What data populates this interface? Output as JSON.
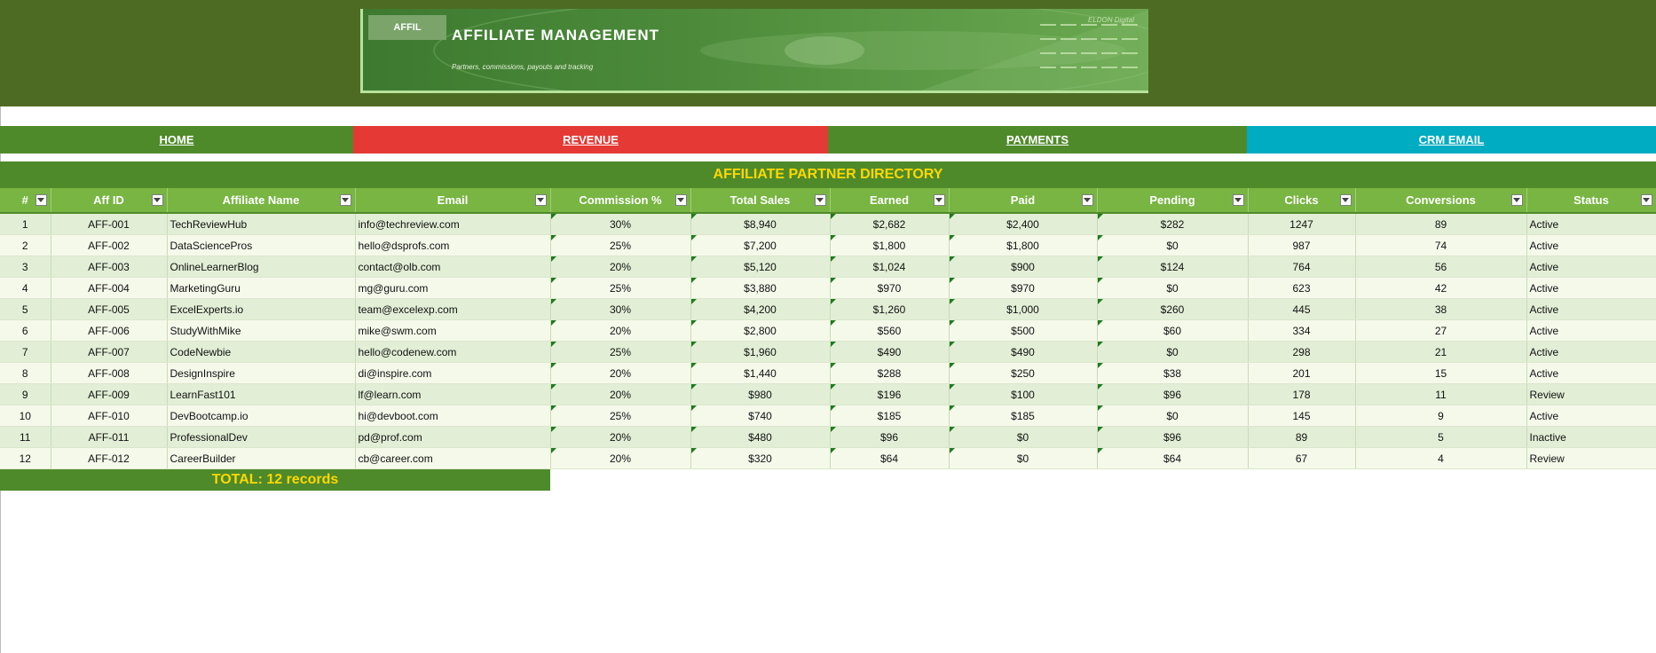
{
  "banner": {
    "badge": "AFFIL",
    "title": "AFFILIATE MANAGEMENT",
    "subtitle": "Partners, commissions, payouts and tracking",
    "brand": "ELDON Digital"
  },
  "nav": [
    {
      "label": "HOME",
      "color": "#4f8a2a"
    },
    {
      "label": "REVENUE",
      "color": "#e53935"
    },
    {
      "label": "PAYMENTS",
      "color": "#4f8a2a"
    },
    {
      "label": "CRM EMAIL",
      "color": "#00acc1"
    }
  ],
  "directory_title": "AFFILIATE PARTNER DIRECTORY",
  "table": {
    "headers": [
      "#",
      "Aff ID",
      "Affiliate Name",
      "Email",
      "Commission %",
      "Total Sales",
      "Earned",
      "Paid",
      "Pending",
      "Clicks",
      "Conversions",
      "Status"
    ],
    "rows": [
      [
        "1",
        "AFF-001",
        "TechReviewHub",
        "info@techreview.com",
        "30%",
        "$8,940",
        "$2,682",
        "$2,400",
        "$282",
        "1247",
        "89",
        "Active"
      ],
      [
        "2",
        "AFF-002",
        "DataSciencePros",
        "hello@dsprofs.com",
        "25%",
        "$7,200",
        "$1,800",
        "$1,800",
        "$0",
        "987",
        "74",
        "Active"
      ],
      [
        "3",
        "AFF-003",
        "OnlineLearnerBlog",
        "contact@olb.com",
        "20%",
        "$5,120",
        "$1,024",
        "$900",
        "$124",
        "764",
        "56",
        "Active"
      ],
      [
        "4",
        "AFF-004",
        "MarketingGuru",
        "mg@guru.com",
        "25%",
        "$3,880",
        "$970",
        "$970",
        "$0",
        "623",
        "42",
        "Active"
      ],
      [
        "5",
        "AFF-005",
        "ExcelExperts.io",
        "team@excelexp.com",
        "30%",
        "$4,200",
        "$1,260",
        "$1,000",
        "$260",
        "445",
        "38",
        "Active"
      ],
      [
        "6",
        "AFF-006",
        "StudyWithMike",
        "mike@swm.com",
        "20%",
        "$2,800",
        "$560",
        "$500",
        "$60",
        "334",
        "27",
        "Active"
      ],
      [
        "7",
        "AFF-007",
        "CodeNewbie",
        "hello@codenew.com",
        "25%",
        "$1,960",
        "$490",
        "$490",
        "$0",
        "298",
        "21",
        "Active"
      ],
      [
        "8",
        "AFF-008",
        "DesignInspire",
        "di@inspire.com",
        "20%",
        "$1,440",
        "$288",
        "$250",
        "$38",
        "201",
        "15",
        "Active"
      ],
      [
        "9",
        "AFF-009",
        "LearnFast101",
        "lf@learn.com",
        "20%",
        "$980",
        "$196",
        "$100",
        "$96",
        "178",
        "11",
        "Review"
      ],
      [
        "10",
        "AFF-010",
        "DevBootcamp.io",
        "hi@devboot.com",
        "25%",
        "$740",
        "$185",
        "$185",
        "$0",
        "145",
        "9",
        "Active"
      ],
      [
        "11",
        "AFF-011",
        "ProfessionalDev",
        "pd@prof.com",
        "20%",
        "$480",
        "$96",
        "$0",
        "$96",
        "89",
        "5",
        "Inactive"
      ],
      [
        "12",
        "AFF-012",
        "CareerBuilder",
        "cb@career.com",
        "20%",
        "$320",
        "$64",
        "$0",
        "$64",
        "67",
        "4",
        "Review"
      ]
    ]
  },
  "total_label": "TOTAL: 12 records"
}
